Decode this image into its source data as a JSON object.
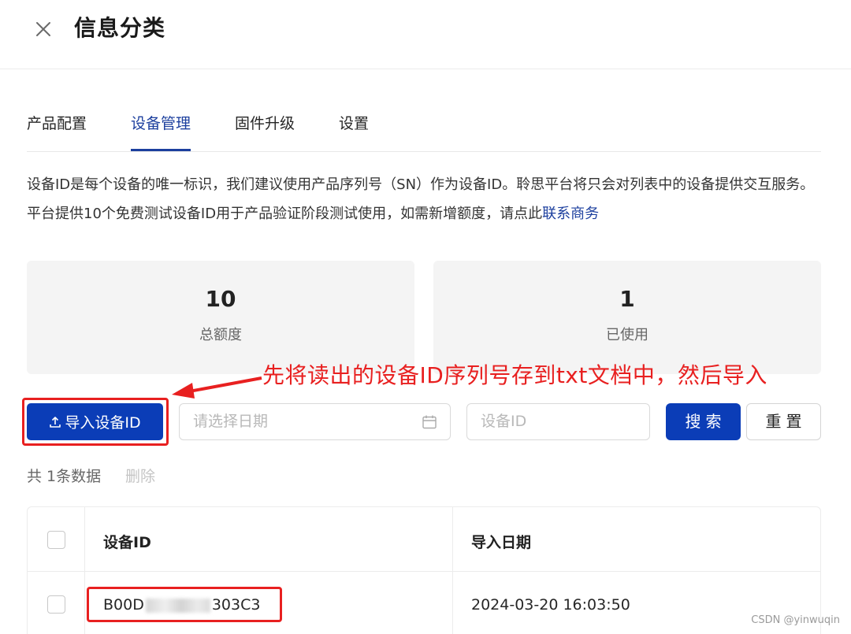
{
  "header": {
    "title": "信息分类"
  },
  "tabs": [
    {
      "label": "产品配置",
      "active": false
    },
    {
      "label": "设备管理",
      "active": true
    },
    {
      "label": "固件升级",
      "active": false
    },
    {
      "label": "设置",
      "active": false
    }
  ],
  "description": {
    "text": "设备ID是每个设备的唯一标识，我们建议使用产品序列号（SN）作为设备ID。聆思平台将只会对列表中的设备提供交互服务。平台提供10个免费测试设备ID用于产品验证阶段测试使用，如需新增额度，请点此",
    "link": "联系商务"
  },
  "stats": [
    {
      "value": "10",
      "label": "总额度"
    },
    {
      "value": "1",
      "label": "已使用"
    }
  ],
  "annotation": {
    "text": "先将读出的设备ID序列号存到txt文档中，然后导入",
    "color": "#e82020"
  },
  "toolbar": {
    "import_label": "导入设备ID",
    "date_placeholder": "请选择日期",
    "device_id_placeholder": "设备ID",
    "search_label": "搜索",
    "reset_label": "重置"
  },
  "summary": {
    "count_text": "共 1条数据",
    "delete_label": "删除"
  },
  "table": {
    "columns": [
      "设备ID",
      "导入日期"
    ],
    "rows": [
      {
        "device_id_prefix": "B00D",
        "device_id_suffix": "303C3",
        "import_date": "2024-03-20 16:03:50"
      }
    ]
  },
  "colors": {
    "primary": "#0b3db7",
    "tab_active": "#1c3f9e",
    "annotation_red": "#e82020"
  },
  "watermark": "CSDN @yinwuqin"
}
